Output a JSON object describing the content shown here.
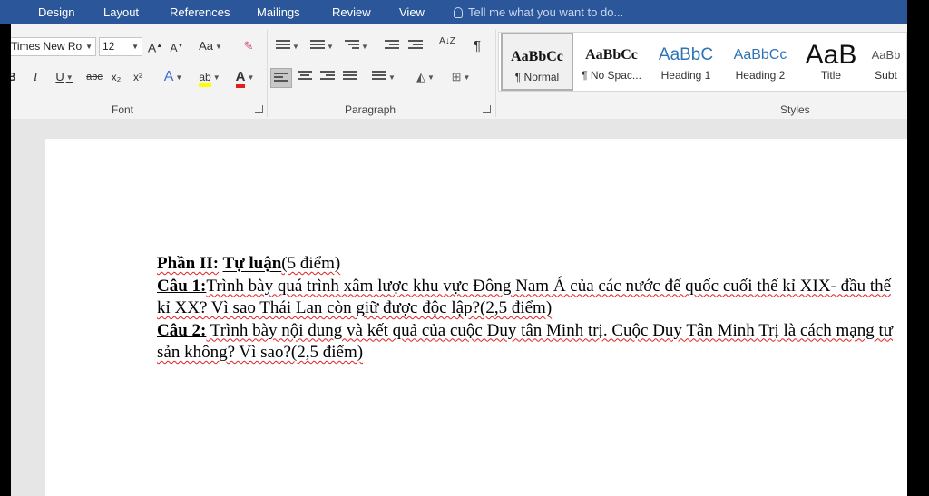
{
  "tabs": [
    "Design",
    "Layout",
    "References",
    "Mailings",
    "Review",
    "View"
  ],
  "tell_me": "Tell me what you want to do...",
  "font": {
    "name": "Times New Ro",
    "size": "12",
    "grow": "A",
    "shrink": "A",
    "change_case": "Aa",
    "bold": "B",
    "italic": "I",
    "underline": "U",
    "strike": "abc",
    "subscript": "x₂",
    "superscript": "x²",
    "text_effects": "A",
    "highlight": "ab",
    "font_color": "A",
    "group_label": "Font"
  },
  "paragraph": {
    "sort": "A↓Z",
    "pilcrow": "¶",
    "group_label": "Paragraph"
  },
  "styles": {
    "group_label": "Styles",
    "items": [
      {
        "sample": "AaBbCc",
        "name": "¶ Normal"
      },
      {
        "sample": "AaBbCc",
        "name": "¶ No Spac..."
      },
      {
        "sample": "AaBbC",
        "name": "Heading 1"
      },
      {
        "sample": "AaBbCc",
        "name": "Heading 2"
      },
      {
        "sample": "AaB",
        "name": "Title"
      },
      {
        "sample": "AaBb",
        "name": "Subt"
      }
    ]
  },
  "document": {
    "p1_a": "Phần II:",
    "p1_b": " ",
    "p1_c": "Tự luận",
    "p1_d": "(5 điểm)",
    "q1_label": "Câu 1:",
    "q1_text": "Trình bày quá trình xâm lược khu vực Đông Nam Á của các nước đế quốc cuối thế kỉ XIX- đầu thế kỉ XX? Vì sao Thái Lan còn giữ được độc lập?(2,5 điểm)",
    "q2_label": "Câu 2:",
    "q2_text": " Trình bày nội dung và kết quả của cuộc Duy tân Minh trị. Cuộc Duy Tân Minh Trị là cách mạng tư sản không?  Vì sao?(2,5 điểm)"
  },
  "colors": {
    "tab_bar": "#2b579a",
    "highlight_yellow": "#ffff00",
    "font_red": "#e02020",
    "heading_blue": "#2e74b5"
  }
}
